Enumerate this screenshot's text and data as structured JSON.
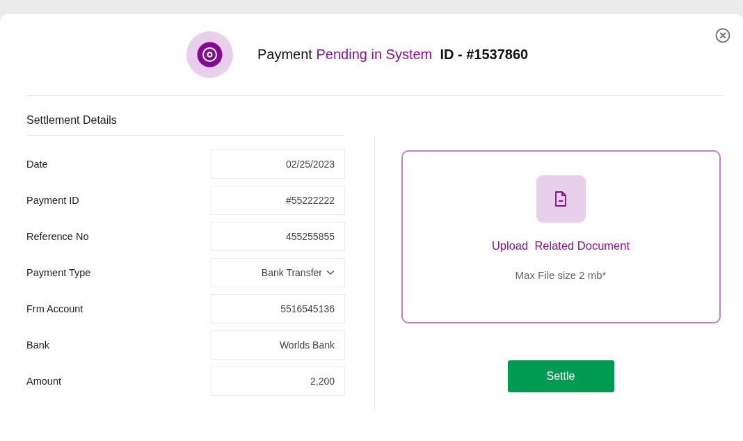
{
  "header": {
    "prefix": "Payment",
    "status": "Pending in System",
    "id": "ID - #1537860"
  },
  "section_title": "Settlement Details",
  "fields": [
    {
      "label": "Date",
      "value": "02/25/2023",
      "kind": "text"
    },
    {
      "label": "Payment ID",
      "value": "#55222222",
      "kind": "text"
    },
    {
      "label": "Reference No",
      "value": "455255855",
      "kind": "text"
    },
    {
      "label": "Payment Type",
      "value": "Bank Transfer",
      "kind": "select"
    },
    {
      "label": "Frm Account",
      "value": "5516545136",
      "kind": "text"
    },
    {
      "label": "Bank",
      "value": "Worlds Bank",
      "kind": "text"
    },
    {
      "label": "Amount",
      "value": "2,200",
      "kind": "text"
    }
  ],
  "upload": {
    "title": "Upload  Related Document",
    "hint": "Max File size 2 mb*"
  },
  "settle_button": "Settle"
}
